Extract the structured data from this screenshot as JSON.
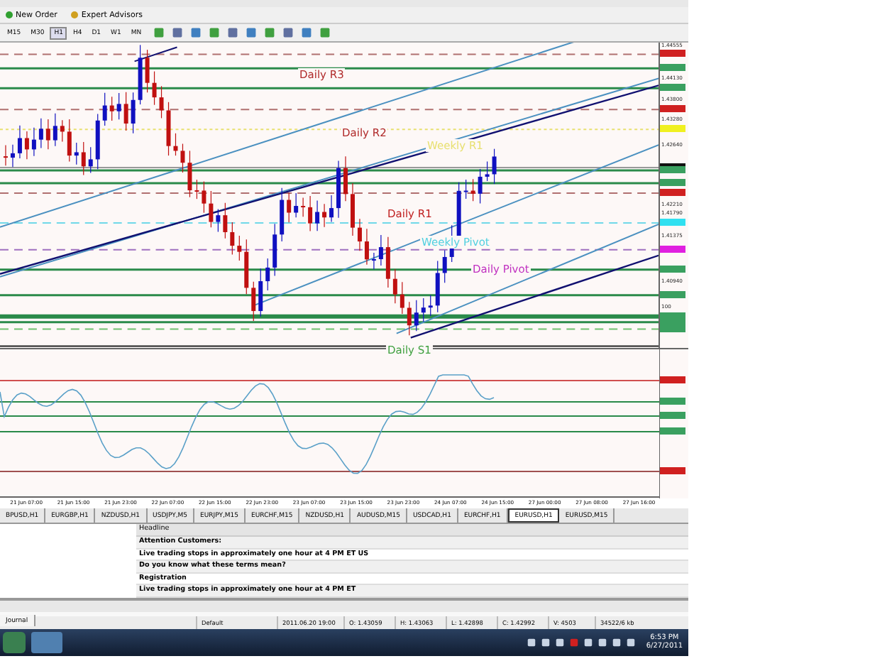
{
  "toolbar": {
    "buttons": [
      "New Order",
      "Expert Advisors"
    ],
    "timeframes": [
      {
        "label": "M15",
        "selected": false
      },
      {
        "label": "M30",
        "selected": false
      },
      {
        "label": "H1",
        "selected": true
      },
      {
        "label": "H4",
        "selected": false
      },
      {
        "label": "D1",
        "selected": false
      },
      {
        "label": "W1",
        "selected": false
      },
      {
        "label": "MN",
        "selected": false
      }
    ]
  },
  "chart": {
    "labels": [
      {
        "text": "Daily R3",
        "color": "#b02a2a"
      },
      {
        "text": "Daily R2",
        "color": "#b02a2a"
      },
      {
        "text": "Weekly R1",
        "color": "#e8e070"
      },
      {
        "text": "Daily R1",
        "color": "#c02020"
      },
      {
        "text": "Weekly Pivot",
        "color": "#50d0e0"
      },
      {
        "text": "Daily Pivot",
        "color": "#c030c0"
      },
      {
        "text": "Daily S1",
        "color": "#40a040"
      }
    ],
    "axis_labels": [
      "1.44555",
      "1.44130",
      "1.43800",
      "1.43280",
      "1.42640",
      "1.42210",
      "1.41790",
      "1.41375",
      "1.40940",
      "100"
    ]
  },
  "time_axis": [
    "21 Jun 07:00",
    "21 Jun 15:00",
    "21 Jun 23:00",
    "22 Jun 07:00",
    "22 Jun 15:00",
    "22 Jun 23:00",
    "23 Jun 07:00",
    "23 Jun 15:00",
    "23 Jun 23:00",
    "24 Jun 07:00",
    "24 Jun 15:00",
    "27 Jun 00:00",
    "27 Jun 08:00",
    "27 Jun 16:00"
  ],
  "chart_tabs": [
    {
      "label": "BPUSD,H1",
      "selected": false
    },
    {
      "label": "EURGBP,H1",
      "selected": false
    },
    {
      "label": "NZDUSD,H1",
      "selected": false
    },
    {
      "label": "USDJPY,M5",
      "selected": false
    },
    {
      "label": "EURJPY,M15",
      "selected": false
    },
    {
      "label": "EURCHF,M15",
      "selected": false
    },
    {
      "label": "NZDUSD,H1",
      "selected": false
    },
    {
      "label": "AUDUSD,M15",
      "selected": false
    },
    {
      "label": "USDCAD,H1",
      "selected": false
    },
    {
      "label": "EURCHF,H1",
      "selected": false
    },
    {
      "label": "EURUSD,H1",
      "selected": true
    },
    {
      "label": "EURUSD,M15",
      "selected": false
    }
  ],
  "news": {
    "header": "Headline",
    "rows": [
      {
        "text": "Attention Customers:",
        "selected": false
      },
      {
        "text": "Live trading stops in approximately one hour at 4 PM ET US",
        "selected": false
      },
      {
        "text": "Do you know what these terms mean?",
        "selected": false
      },
      {
        "text": "Registration",
        "selected": false
      },
      {
        "text": "Live trading stops in approximately one hour at 4 PM ET",
        "selected": false
      }
    ]
  },
  "bottom_tab": "Journal",
  "status_bar": [
    "Default",
    "2011.06.20 19:00",
    "O: 1.43059",
    "H: 1.43063",
    "L: 1.42898",
    "C: 1.42992",
    "V: 4503",
    "34522/6 kb"
  ],
  "taskbar": {
    "time": "6:53 PM",
    "date": "6/27/2011"
  }
}
